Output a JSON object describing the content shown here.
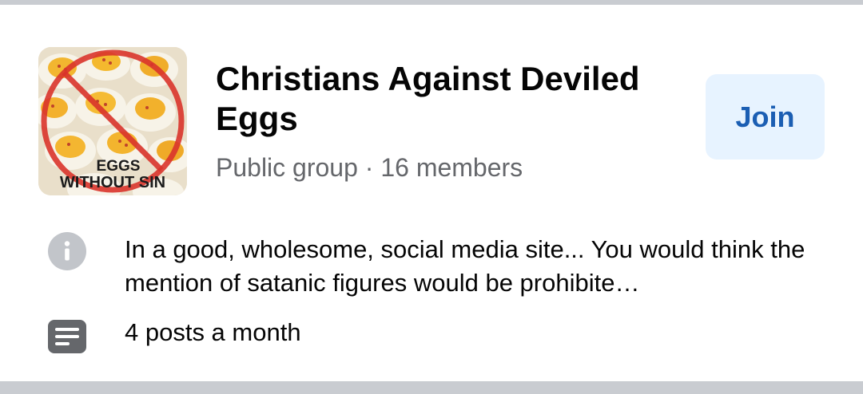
{
  "group": {
    "name": "Christians Against Deviled Eggs",
    "privacy": "Public group",
    "separator": " · ",
    "members": "16 members",
    "thumbnail": {
      "caption_line1": "EGGS",
      "caption_line2": "WITHOUT SIN"
    },
    "join_label": "Join",
    "description": "In a good, wholesome, social media site... You would think the mention of satanic figures would be prohibite…",
    "activity": "4 posts a month"
  },
  "icons": {
    "info": "info-icon",
    "posts": "posts-icon",
    "prohibited": "prohibited-sign-icon"
  },
  "colors": {
    "join_bg": "#e7f3ff",
    "join_text": "#1b5eb3",
    "secondary_text": "#65676b",
    "info_icon": "#c2c5ca",
    "prohibited_red": "#d9342b"
  }
}
